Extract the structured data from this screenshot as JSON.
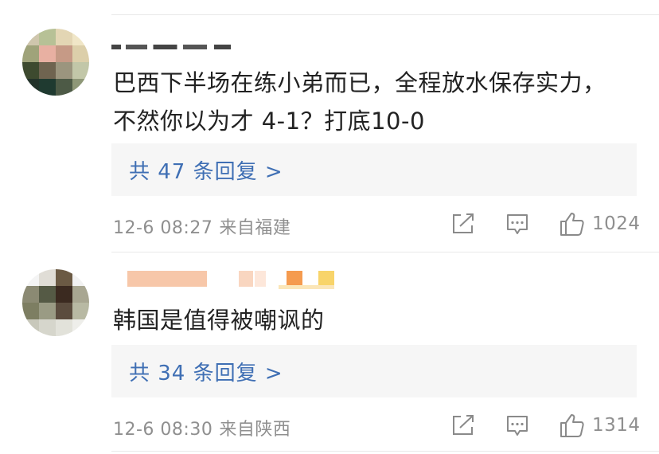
{
  "comments": [
    {
      "text_line1": "巴西下半场在练小弟而已，全程放水保存实力，",
      "text_line2": "不然你以为才 4-1？打底10-0",
      "reply_label": "共 47 条回复 >",
      "time": "12-6 08:27",
      "source": "来自福建",
      "likes": "1024"
    },
    {
      "text_line1": "韩国是值得被嘲讽的",
      "reply_label": "共 34 条回复 >",
      "time": "12-6 08:30",
      "source": "来自陕西",
      "likes": "1314"
    }
  ],
  "icons": {
    "share": "share-icon",
    "comment": "comment-icon",
    "like": "thumbs-up-icon"
  },
  "colors": {
    "link_blue": "#3f6fb4",
    "meta_gray": "#8f8f8f",
    "text": "#222222",
    "reply_bg": "#f6f6f6"
  }
}
